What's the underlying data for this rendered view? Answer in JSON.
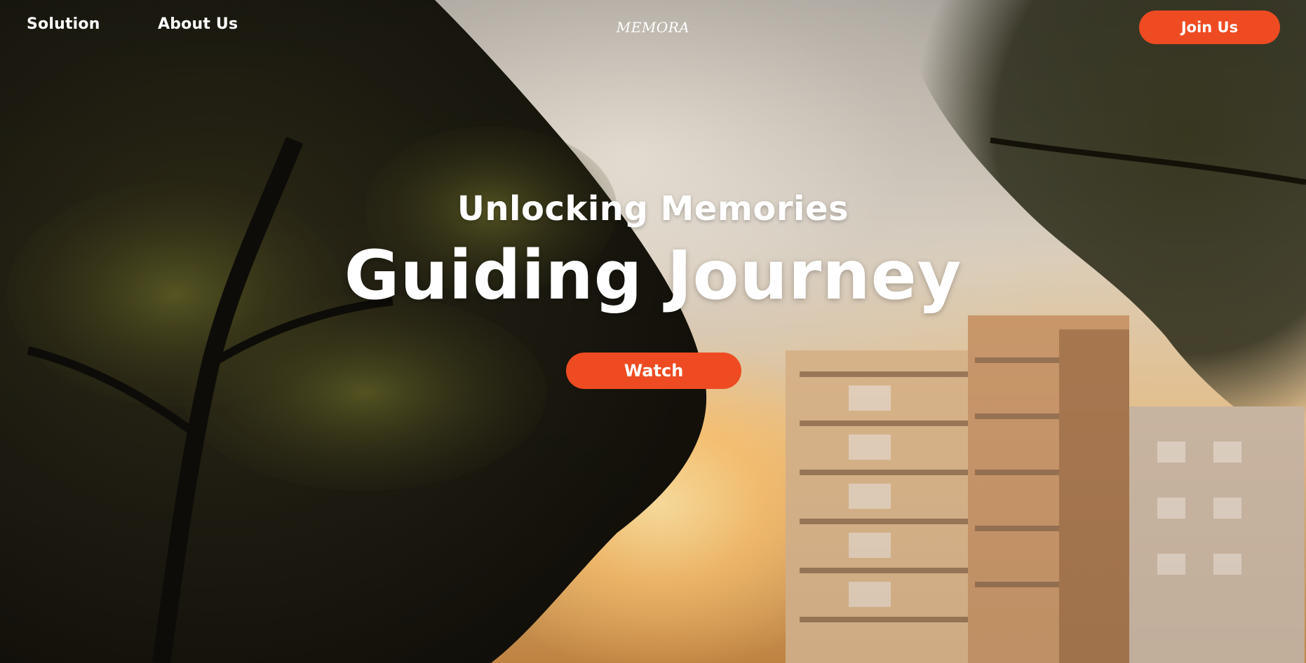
{
  "nav": {
    "solution_label": "Solution",
    "about_label": "About Us",
    "brand": "MEMORA",
    "join_label": "Join Us"
  },
  "hero": {
    "subtitle": "Unlocking Memories",
    "title": "Guiding Journey",
    "watch_label": "Watch",
    "background": "hero-photo-trees-building-sunset"
  },
  "colors": {
    "accent": "#ee4b22",
    "text": "#ffffff"
  }
}
